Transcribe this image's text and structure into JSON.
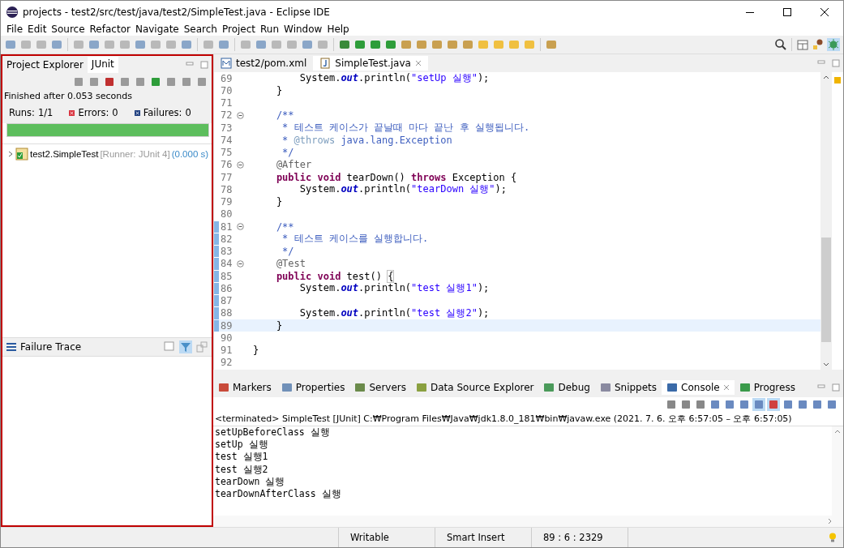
{
  "window": {
    "title": "projects - test2/src/test/java/test2/SimpleTest.java - Eclipse IDE"
  },
  "menu": [
    "File",
    "Edit",
    "Source",
    "Refactor",
    "Navigate",
    "Search",
    "Project",
    "Run",
    "Window",
    "Help"
  ],
  "left_panel": {
    "tabs": [
      {
        "label": "Project Explorer",
        "selected": false
      },
      {
        "label": "JUnit",
        "selected": true
      }
    ],
    "status": "Finished after 0.053 seconds",
    "counters": [
      {
        "kind": "runs",
        "label": "Runs:",
        "value": "1/1"
      },
      {
        "kind": "errors",
        "label": "Errors:",
        "value": "0"
      },
      {
        "kind": "failures",
        "label": "Failures:",
        "value": "0"
      }
    ],
    "progress": {
      "level": 1
    },
    "tree": [
      {
        "name": "test2.SimpleTest",
        "runner": "[Runner: JUnit 4]",
        "time": "(0.000 s)",
        "expanded": false
      }
    ],
    "failure_trace": {
      "title": "Failure Trace"
    }
  },
  "editor": {
    "tabs": [
      {
        "label": "test2/pom.xml",
        "kind": "xml",
        "selected": false
      },
      {
        "label": "SimpleTest.java",
        "kind": "java",
        "selected": true
      }
    ],
    "lines": [
      {
        "number": "69",
        "foldable": false,
        "changed": false,
        "current": false,
        "tokens": [
          {
            "kind": "plain",
            "text": "        System."
          },
          {
            "kind": "field",
            "text": "out"
          },
          {
            "kind": "plain",
            "text": ".println("
          },
          {
            "kind": "string",
            "text": "\"setUp 실행\""
          },
          {
            "kind": "plain",
            "text": ");"
          }
        ]
      },
      {
        "number": "70",
        "foldable": false,
        "changed": false,
        "current": false,
        "tokens": [
          {
            "kind": "plain",
            "text": "    }"
          }
        ]
      },
      {
        "number": "71",
        "foldable": false,
        "changed": false,
        "current": false
      },
      {
        "number": "72",
        "foldable": true,
        "changed": false,
        "current": false,
        "tokens": [
          {
            "kind": "doc",
            "text": "    /**"
          }
        ]
      },
      {
        "number": "73",
        "foldable": false,
        "changed": false,
        "current": false,
        "tokens": [
          {
            "kind": "doc",
            "text": "     * 테스트 케이스가 끝날때 마다 끝난 후 실행됩니다."
          }
        ]
      },
      {
        "number": "74",
        "foldable": false,
        "changed": false,
        "current": false,
        "tokens": [
          {
            "kind": "doc",
            "text": "     * "
          },
          {
            "kind": "doctag",
            "text": "@throws"
          },
          {
            "kind": "doc",
            "text": " java.lang.Exception"
          }
        ]
      },
      {
        "number": "75",
        "foldable": false,
        "changed": false,
        "current": false,
        "tokens": [
          {
            "kind": "doc",
            "text": "     */"
          }
        ]
      },
      {
        "number": "76",
        "foldable": true,
        "changed": false,
        "current": false,
        "tokens": [
          {
            "kind": "annotation",
            "text": "    @After"
          }
        ]
      },
      {
        "number": "77",
        "foldable": false,
        "changed": false,
        "current": false,
        "tokens": [
          {
            "kind": "keyword",
            "text": "    public void"
          },
          {
            "kind": "plain",
            "text": " tearDown() "
          },
          {
            "kind": "keyword",
            "text": "throws"
          },
          {
            "kind": "plain",
            "text": " Exception {"
          }
        ]
      },
      {
        "number": "78",
        "foldable": false,
        "changed": false,
        "current": false,
        "tokens": [
          {
            "kind": "plain",
            "text": "        System."
          },
          {
            "kind": "field",
            "text": "out"
          },
          {
            "kind": "plain",
            "text": ".println("
          },
          {
            "kind": "string",
            "text": "\"tearDown 실행\""
          },
          {
            "kind": "plain",
            "text": ");"
          }
        ]
      },
      {
        "number": "79",
        "foldable": false,
        "changed": false,
        "current": false,
        "tokens": [
          {
            "kind": "plain",
            "text": "    }"
          }
        ]
      },
      {
        "number": "80",
        "foldable": false,
        "changed": false,
        "current": false
      },
      {
        "number": "81",
        "foldable": true,
        "changed": true,
        "current": false,
        "tokens": [
          {
            "kind": "doc",
            "text": "    /**"
          }
        ]
      },
      {
        "number": "82",
        "foldable": false,
        "changed": true,
        "current": false,
        "tokens": [
          {
            "kind": "doc",
            "text": "     * 테스트 케이스를 실행합니다."
          }
        ]
      },
      {
        "number": "83",
        "foldable": false,
        "changed": true,
        "current": false,
        "tokens": [
          {
            "kind": "doc",
            "text": "     */"
          }
        ]
      },
      {
        "number": "84",
        "foldable": true,
        "changed": true,
        "current": false,
        "tokens": [
          {
            "kind": "annotation",
            "text": "    @Test"
          }
        ]
      },
      {
        "number": "85",
        "foldable": false,
        "changed": true,
        "current": false,
        "tokens": [
          {
            "kind": "keyword",
            "text": "    public void"
          },
          {
            "kind": "plain",
            "text": " test() "
          },
          {
            "kind": "bracket",
            "text": "{"
          }
        ]
      },
      {
        "number": "86",
        "foldable": false,
        "changed": true,
        "current": false,
        "tokens": [
          {
            "kind": "plain",
            "text": "        System."
          },
          {
            "kind": "field",
            "text": "out"
          },
          {
            "kind": "plain",
            "text": ".println("
          },
          {
            "kind": "string",
            "text": "\"test 실행1\""
          },
          {
            "kind": "plain",
            "text": ");"
          }
        ]
      },
      {
        "number": "87",
        "foldable": false,
        "changed": true,
        "current": false
      },
      {
        "number": "88",
        "foldable": false,
        "changed": true,
        "current": false,
        "tokens": [
          {
            "kind": "plain",
            "text": "        System."
          },
          {
            "kind": "field",
            "text": "out"
          },
          {
            "kind": "plain",
            "text": ".println("
          },
          {
            "kind": "string",
            "text": "\"test 실행2\""
          },
          {
            "kind": "plain",
            "text": ");"
          }
        ]
      },
      {
        "number": "89",
        "foldable": false,
        "changed": true,
        "current": true,
        "tokens": [
          {
            "kind": "plain",
            "text": "    }"
          }
        ]
      },
      {
        "number": "90",
        "foldable": false,
        "changed": false,
        "current": false
      },
      {
        "number": "91",
        "foldable": false,
        "changed": false,
        "current": false,
        "tokens": [
          {
            "kind": "plain",
            "text": "}"
          }
        ]
      },
      {
        "number": "92",
        "foldable": false,
        "changed": false,
        "current": false
      }
    ]
  },
  "bottom_panel": {
    "tabs": [
      {
        "label": "Markers",
        "selected": false
      },
      {
        "label": "Properties",
        "selected": false
      },
      {
        "label": "Servers",
        "selected": false
      },
      {
        "label": "Data Source Explorer",
        "selected": false
      },
      {
        "label": "Debug",
        "selected": false
      },
      {
        "label": "Snippets",
        "selected": false
      },
      {
        "label": "Console",
        "selected": true
      },
      {
        "label": "Progress",
        "selected": false
      }
    ],
    "console_header": "<terminated> SimpleTest [JUnit] C:₩Program Files₩Java₩jdk1.8.0_181₩bin₩javaw.exe  (2021. 7. 6. 오후 6:57:05 – 오후 6:57:05)",
    "console_lines": [
      "setUpBeforeClass 실행",
      "setUp 실행",
      "test 실행1",
      "test 실행2",
      "tearDown 실행",
      "tearDownAfterClass 실행"
    ]
  },
  "status_bar": [
    "Writable",
    "Smart Insert",
    "89 : 6 : 2329"
  ]
}
